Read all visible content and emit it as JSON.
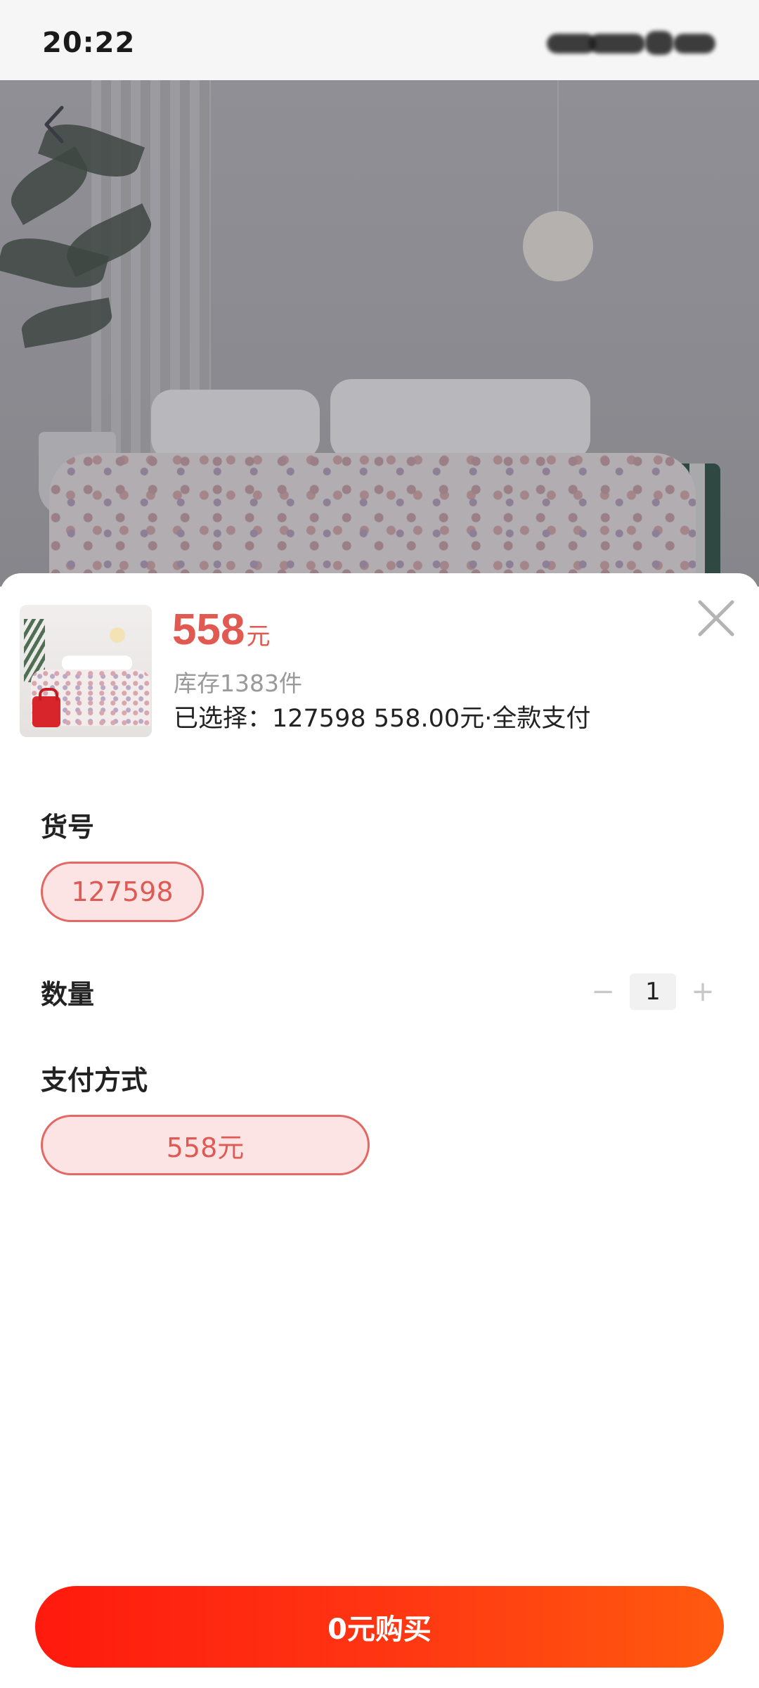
{
  "status_bar": {
    "time": "20:22"
  },
  "product": {
    "price": "558",
    "price_unit": "元",
    "stock": "库存1383件",
    "selected": "已选择：127598 558.00元·全款支付"
  },
  "sections": {
    "item_no": {
      "title": "货号",
      "option": "127598"
    },
    "quantity": {
      "title": "数量",
      "minus": "−",
      "value": "1",
      "plus": "+"
    },
    "payment": {
      "title": "支付方式",
      "option": "558元"
    }
  },
  "buy_button": {
    "label": "0元购买"
  },
  "colors": {
    "accent": "#e05a52",
    "button_start": "#ff1a0e",
    "button_end": "#ff5a0f",
    "pill_bg": "#fde4e4"
  }
}
